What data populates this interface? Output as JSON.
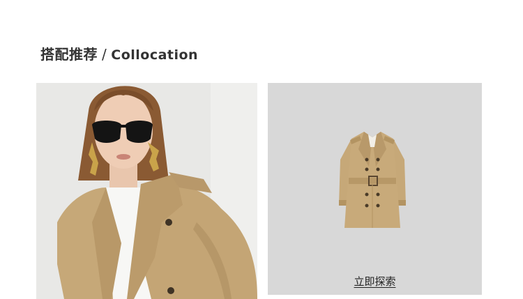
{
  "section": {
    "title_cn": "搭配推荐",
    "separator": "/",
    "title_en": "Collocation"
  },
  "right_panel": {
    "explore_label": "立即探索"
  },
  "colors": {
    "coat": "#c6a878",
    "panel_left_bg": "#e9e9e7",
    "panel_right_bg": "#d8d8d8",
    "title": "#333333"
  }
}
